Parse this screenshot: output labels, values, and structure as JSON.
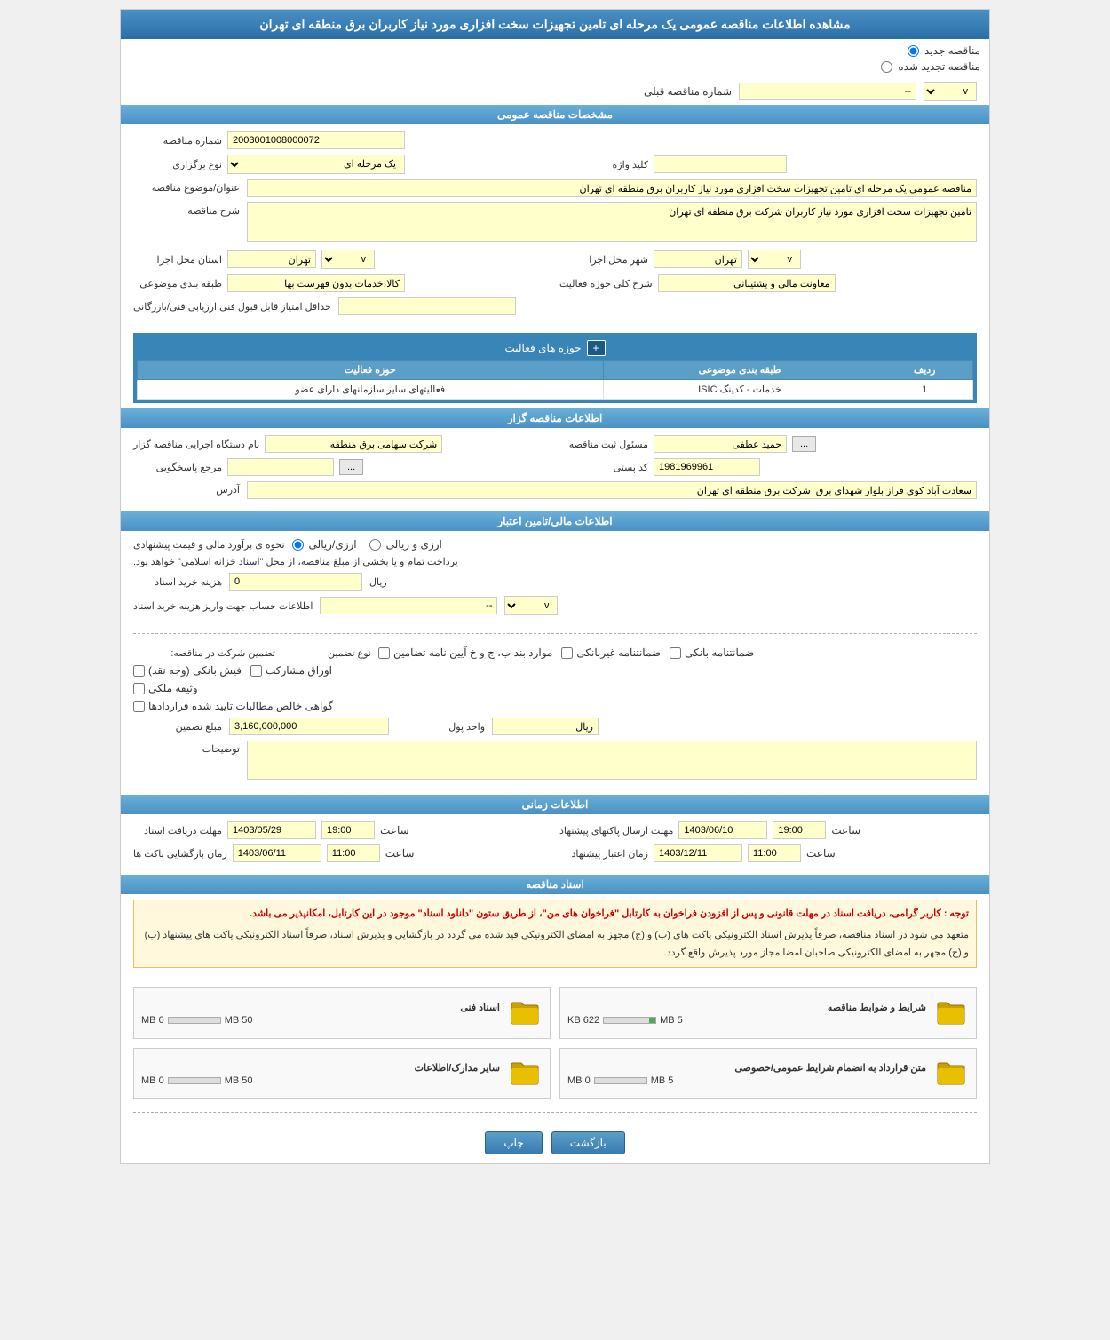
{
  "page": {
    "title": "مشاهده اطلاعات مناقصه عمومی یک مرحله ای تامین تجهیزات سخت افزاری مورد نیاز کاربران برق منطقه ای تهران"
  },
  "options": {
    "new_tender": "مناقصه جدید",
    "renewed_tender": "مناقصه تجدید شده",
    "prev_tender_label": "شماره مناقصه قبلی",
    "prev_tender_value": "--"
  },
  "general_specs": {
    "header": "مشخصات مناقصه عمومی",
    "tender_number_label": "شماره مناقصه",
    "tender_number_value": "2003001008000072",
    "type_label": "نوع برگزاری",
    "type_value": "یک مرحله ای",
    "keyword_label": "کلید واژه",
    "keyword_value": "",
    "title_label": "عنوان/موضوع مناقصه",
    "title_value": "مناقصه عمومی یک مرحله ای تامین تجهیزات سخت افزاری مورد نیاز کاربران برق منطقه ای تهران",
    "description_label": "شرح مناقصه",
    "description_value": "تامین تجهیزات سخت افزاری مورد نیاز کاربران شرکت برق منطقه ای تهران",
    "province_label": "استان محل اجرا",
    "province_value": "تهران",
    "city_label": "شهر محل اجرا",
    "city_value": "تهران",
    "activity_desc_label": "شرح کلی حوزه فعالیت",
    "activity_desc_value": "معاونت مالی و پشتیبانی",
    "category_label": "طبقه بندی موضوعی",
    "category_value": "کالا،خدمات بدون فهرست بها",
    "min_score_label": "حداقل امتیاز قابل قبول فنی ارزیابی فنی/بازرگانی",
    "min_score_value": ""
  },
  "activity_table": {
    "header": "حوزه های فعالیت",
    "add_button": "+",
    "columns": [
      "ردیف",
      "طبقه بندی موضوعی",
      "حوزه فعالیت"
    ],
    "rows": [
      {
        "row": "1",
        "category": "خدمات - کدینگ ISIC",
        "activity": "فعالیتهای سایر سازمانهای دارای عضو"
      }
    ]
  },
  "organizer_info": {
    "header": "اطلاعات مناقصه گزار",
    "name_label": "نام دستگاه اجرایی مناقصه گزار",
    "name_value": "شرکت سهامی برق منطقه",
    "responsible_label": "مسئول ثبت مناقصه",
    "responsible_value": "حمید عظفی",
    "reference_label": "مرجع پاسخگویی",
    "reference_value": "",
    "postal_label": "کد پستی",
    "postal_value": "1981969961",
    "address_label": "آدرس",
    "address_value": "سعادت آباد کوی فراز بلوار شهدای برق  شرکت برق منطقه ای تهران"
  },
  "financial_info": {
    "header": "اطلاعات مالی/تامین اعتبار",
    "estimate_label": "نحوه ی برآورد مالی و قیمت پیشنهادی",
    "estimate_rial": "ارزی/ریالی",
    "estimate_foreign": "ارزی و ریالی",
    "payment_note": "پرداخت تمام و یا بخشی از مبلغ مناقصه، از محل \"اسناد خزانه اسلامی\" خواهد بود.",
    "purchase_cost_label": "هزینه خرید اسناد",
    "purchase_cost_value": "0",
    "purchase_cost_unit": "ریال",
    "account_label": "اطلاعات حساب جهت واریز هزینه خرید اسناد",
    "account_value": "--"
  },
  "guarantee": {
    "participation_label": "تضمین شرکت در مناقصه",
    "type_label": "نوع تضمین",
    "items": [
      {
        "label": "ضمانتنامه بانکی",
        "checked": false
      },
      {
        "label": "ضمانتنامه غیربانکی",
        "checked": false
      },
      {
        "label": "موارد بند ب، ج و خ آیین نامه تضامین",
        "checked": false
      },
      {
        "label": "فیش بانکی (وجه نقد)",
        "checked": false
      },
      {
        "label": "اوراق مشارکت",
        "checked": false
      },
      {
        "label": "وثیقه ملکی",
        "checked": false
      },
      {
        "label": "گواهی خالص مطالبات تایید شده فراردادها",
        "checked": false
      }
    ],
    "amount_label": "مبلغ تضمین",
    "amount_value": "3,160,000,000",
    "unit_label": "واحد پول",
    "unit_value": "ریال",
    "notes_label": "توضیحات",
    "notes_value": ""
  },
  "time_info": {
    "header": "اطلاعات زمانی",
    "doc_receipt_label": "مهلت دریافت اسناد",
    "doc_receipt_date": "1403/05/29",
    "doc_receipt_time": "19:00",
    "doc_receipt_time_label": "ساعت",
    "doc_send_label": "مهلت ارسال پاکتهای پیشنهاد",
    "doc_send_date": "1403/06/10",
    "doc_send_time": "19:00",
    "doc_send_time_label": "ساعت",
    "opening_label": "زمان بازگشایی باکت ها",
    "opening_date": "1403/06/11",
    "opening_time": "11:00",
    "opening_time_label": "ساعت",
    "validity_label": "زمان اعتبار پیشنهاد",
    "validity_date": "1403/12/11",
    "validity_time": "11:00",
    "validity_time_label": "ساعت"
  },
  "documents": {
    "header": "اسناد مناقصه",
    "notice": {
      "red_text": "توجه : کاربر گرامی، دریافت اسناد در مهلت قانونی و پس از افزودن فراخوان به کارتابل \"فراخوان های من\"، از طریق ستون \"دانلود اسناد\" موجود در این کارتابل، امکانپذیر می باشد.",
      "body": "متعهد می شود در اسناد مناقصه، صرفاً پذیرش اسناد الکترونیکی پاکت های (ب) و (ج) مجهز به امضای الکترونیکی قید شده می گردد در بازگشایی و پذیرش اسناد، صرفاً اسناد الکترونیکی پاکت های پیشنهاد (ب) و (ج) مجهر به امضای الکترونیکی صاحبان امضا مجاز مورد پذیرش واقع گردد."
    },
    "files": [
      {
        "name": "شرایط و ضوابط مناقصه",
        "current_size": "622 KB",
        "max_size": "5 MB",
        "progress": 12
      },
      {
        "name": "اسناد فنی",
        "current_size": "0 MB",
        "max_size": "50 MB",
        "progress": 0
      },
      {
        "name": "متن قرارداد به انضمام شرایط عمومی/خصوصی",
        "current_size": "0 MB",
        "max_size": "5 MB",
        "progress": 0
      },
      {
        "name": "سایر مدارک/اطلاعات",
        "current_size": "0 MB",
        "max_size": "50 MB",
        "progress": 0
      }
    ]
  },
  "buttons": {
    "print": "چاپ",
    "back": "بازگشت"
  }
}
